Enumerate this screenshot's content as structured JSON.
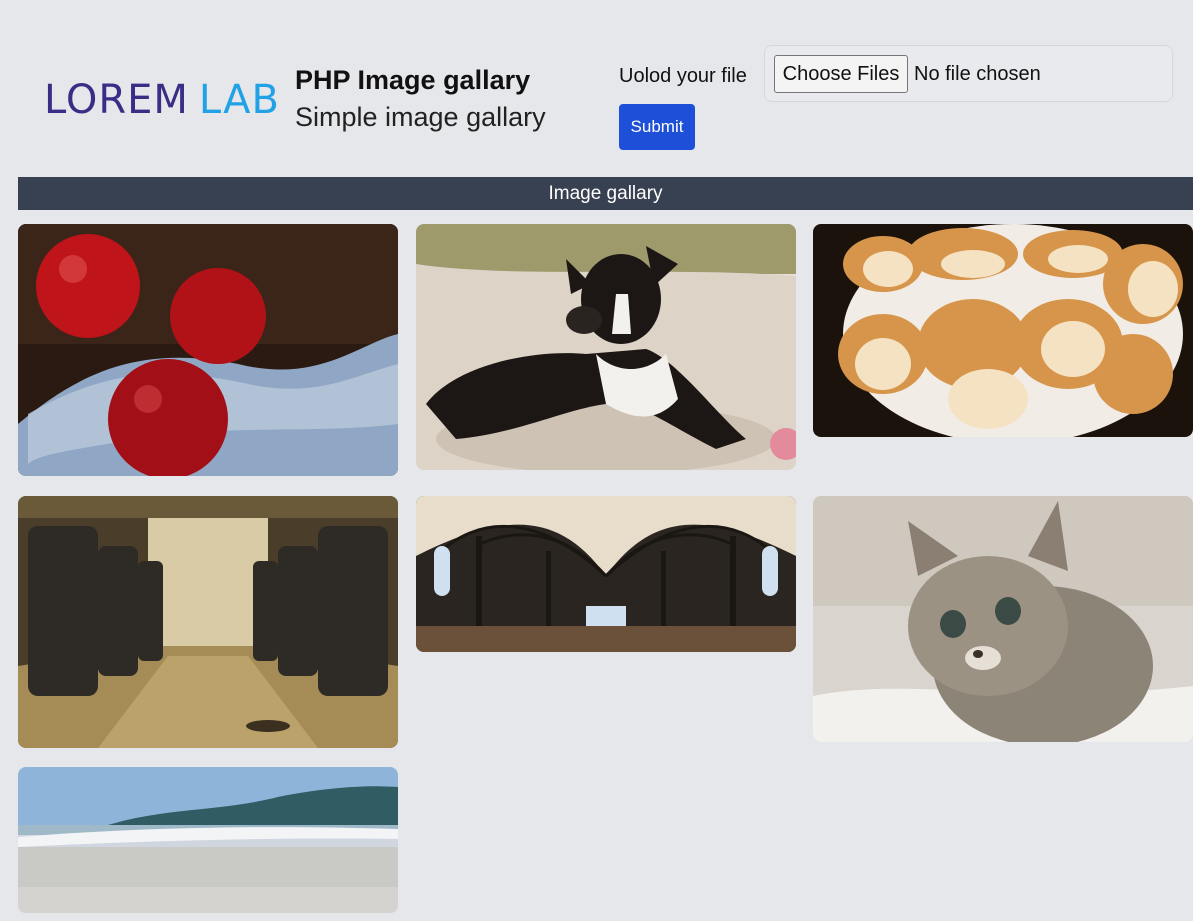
{
  "header": {
    "logo_part1": "LOREM",
    "logo_part2": "LAB",
    "title": "PHP Image gallary",
    "subtitle": "Simple image gallary"
  },
  "upload": {
    "label": "Uolod your file",
    "choose_label": "Choose Files",
    "file_status": "No file chosen",
    "submit_label": "Submit"
  },
  "gallery": {
    "heading": "Image gallary",
    "images": [
      {
        "name": "apples-photo"
      },
      {
        "name": "puppy-photo"
      },
      {
        "name": "bread-photo"
      },
      {
        "name": "bus-interior-photo"
      },
      {
        "name": "library-hall-photo"
      },
      {
        "name": "kitten-photo"
      },
      {
        "name": "beach-photo"
      }
    ]
  },
  "colors": {
    "background": "#e6e7eb",
    "logo_dark": "#3a2d86",
    "logo_light": "#22a2e6",
    "submit": "#1d4fd8",
    "bar": "#374151"
  }
}
